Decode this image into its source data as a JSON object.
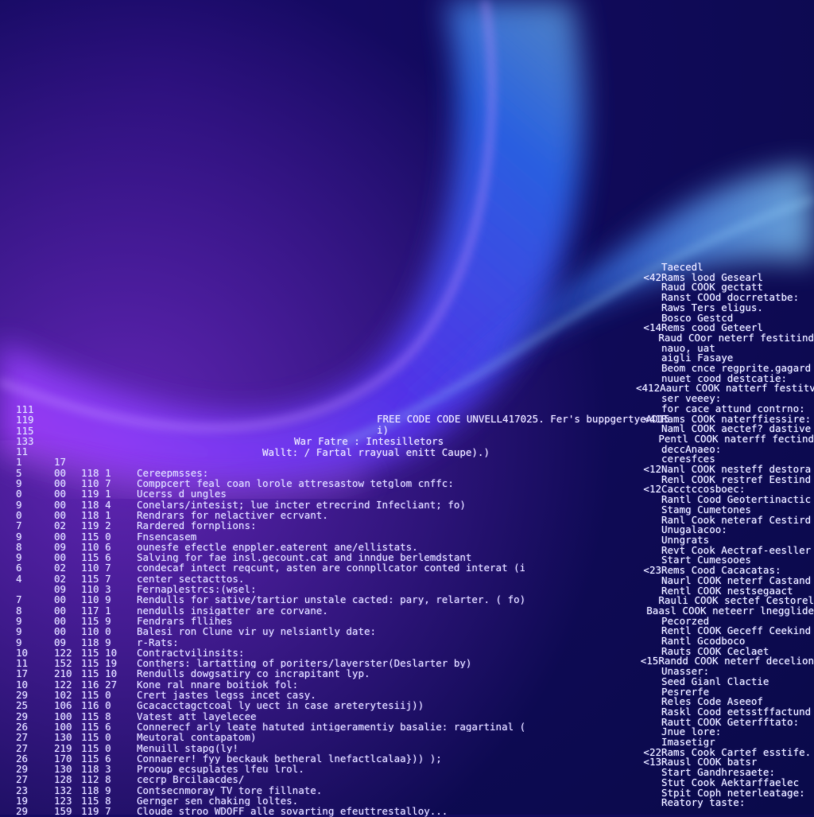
{
  "palette": {
    "bg_top": "#150a6a",
    "bg_bottom": "#0a0a4a",
    "wave_violet": "#9b3bff",
    "wave_blue": "#2f74ff",
    "wave_cyan": "#74c8ff",
    "text": "#dcd6ff"
  },
  "center_lines": [
    "FREE CODE CODE UNVELL417025. Fer's buppgertyeAD15",
    "i)",
    "War Fatre : Intesilletors",
    "Wallt: / Fartal rrayual enitt Caupe).)"
  ],
  "left_lines": [
    {
      "a": "111",
      "b": "",
      "c": "",
      "t": ""
    },
    {
      "a": "119",
      "b": "",
      "c": "",
      "t": ""
    },
    {
      "a": "115",
      "b": "",
      "c": "",
      "t": ""
    },
    {
      "a": "133",
      "b": "",
      "c": "",
      "t": ""
    },
    {
      "a": "11",
      "b": "",
      "c": "",
      "t": ""
    },
    {
      "a": "1",
      "b": "17",
      "c": "",
      "t": ""
    },
    {
      "a": "5",
      "b": "00",
      "c": "118 1",
      "t": "Cereepmsses:"
    },
    {
      "a": "9",
      "b": "00",
      "c": "110 7",
      "t": "Comppcert feal coan lorole attresastow tetglom cnffc:"
    },
    {
      "a": "0",
      "b": "00",
      "c": "119 1",
      "t": "Ucerss d ungles"
    },
    {
      "a": "9",
      "b": "00",
      "c": "118 4",
      "t": "Conelars/intesist; lue incter etrecrind Infecliant; fo)"
    },
    {
      "a": "0",
      "b": "00",
      "c": "118 1",
      "t": "Rendrars for nelactiver ecrvant."
    },
    {
      "a": "7",
      "b": "02",
      "c": "119 2",
      "t": "Rardered fornplions:"
    },
    {
      "a": "9",
      "b": "00",
      "c": "115 0",
      "t": "Fnsencasem"
    },
    {
      "a": "8",
      "b": "09",
      "c": "110 6",
      "t": "ounesfe efectle enppler.eaterent ane/ellistats."
    },
    {
      "a": "9",
      "b": "00",
      "c": "115 6",
      "t": "Salving for fae insl.gecount.cat and inndue berlemdstant"
    },
    {
      "a": "6",
      "b": "02",
      "c": "110 7",
      "t": "condecaf intect reqcunt, asten are connpllcator conted interat (i))"
    },
    {
      "a": "4",
      "b": "02",
      "c": "115 7",
      "t": "center sectacttos."
    },
    {
      "a": "",
      "b": "09",
      "c": "110 3",
      "t": "Fernaplestrcs:(wsel:"
    },
    {
      "a": "7",
      "b": "00",
      "c": "110 9",
      "t": "Rendulls for sative/tartior unstale cacted: pary, relarter. ( fo)"
    },
    {
      "a": "8",
      "b": "00",
      "c": "117 1",
      "t": "nendulls insigatter are corvane."
    },
    {
      "a": "9",
      "b": "00",
      "c": "115 9",
      "t": "Fendrars fllihes"
    },
    {
      "a": "9",
      "b": "00",
      "c": "110 0",
      "t": "Balesi ron Clune vir uy nelsiantly date:"
    },
    {
      "a": "9",
      "b": "09",
      "c": "118 9",
      "t": "r-Rats:"
    },
    {
      "a": "",
      "b": "",
      "c": "",
      "t": ""
    },
    {
      "a": "10",
      "b": "122",
      "c": "115 10",
      "t": "Contractvilinsits:"
    },
    {
      "a": "11",
      "b": "152",
      "c": "115 19",
      "t": "Conthers: lartatting of poriters/laverster(Deslarter by)"
    },
    {
      "a": "17",
      "b": "210",
      "c": "115 10",
      "t": "Rendulls dowgsatiry co incrapitant lyp."
    },
    {
      "a": "10",
      "b": "122",
      "c": "116 27",
      "t": "Kone ral nnare boitiok fol:"
    },
    {
      "a": "29",
      "b": "102",
      "c": "115 0",
      "t": "Crert jastes legss incet casy."
    },
    {
      "a": "25",
      "b": "106",
      "c": "116 0",
      "t": "Gcacacctagctcoal ly uect in case areterytesiij))"
    },
    {
      "a": "29",
      "b": "100",
      "c": "115 8",
      "t": "Vatest att layelecee"
    },
    {
      "a": "26",
      "b": "100",
      "c": "115 6",
      "t": "Connerecf arly leate hatuted intigeramentiy basalie: ragartinal ("
    },
    {
      "a": "27",
      "b": "130",
      "c": "115 0",
      "t": "Meutoral contapatom)"
    },
    {
      "a": "27",
      "b": "219",
      "c": "115 0",
      "t": "Menuill stapg(ly!"
    },
    {
      "a": "26",
      "b": "170",
      "c": "115 6",
      "t": "Connaerer! fyy beckauk betheral lnefactlcalaa})) );"
    },
    {
      "a": "29",
      "b": "130",
      "c": "118 3",
      "t": "Prooup ecsuplates lfeu lrol."
    },
    {
      "a": "27",
      "b": "128",
      "c": "112 8",
      "t": "cecrp Brcilaacdes/"
    },
    {
      "a": "23",
      "b": "132",
      "c": "118 9",
      "t": "Contsecnmoray TV tore fillnate."
    },
    {
      "a": "19",
      "b": "123",
      "c": "115 8",
      "t": "Gernger sen chaking loltes."
    },
    {
      "a": "29",
      "b": "159",
      "c": "119 7",
      "t": "Cloude stroo WDOFF alle sovarting efeuttrestalloy..."
    }
  ],
  "right_lines": [
    {
      "n": "",
      "t": "Taecedl"
    },
    {
      "n": "<42",
      "t": "Rams lood Gesearl"
    },
    {
      "n": "",
      "t": "Raud COOK gectatt"
    },
    {
      "n": "",
      "t": "Ranst COOd docrretatbe:"
    },
    {
      "n": "",
      "t": "Raws Ters eligus."
    },
    {
      "n": "",
      "t": "Bosco Gestcd"
    },
    {
      "n": "<14",
      "t": "Rems cood Geteerl"
    },
    {
      "n": "",
      "t": "Raud COor neterf festitind"
    },
    {
      "n": "",
      "t": "nauo, uat"
    },
    {
      "n": "",
      "t": "aigli Fasaye"
    },
    {
      "n": "",
      "t": "Beom cnce regprite.gagard"
    },
    {
      "n": "",
      "t": "nuuet cood destcatie:"
    },
    {
      "n": "<412",
      "t": "Aaurt COOK natterf festitve"
    },
    {
      "n": "",
      "t": "ser veeey:"
    },
    {
      "n": "",
      "t": "for cace attund contrno:"
    },
    {
      "n": "",
      "t": ""
    },
    {
      "n": "",
      "t": ""
    },
    {
      "n": "<41",
      "t": "Rams COOK naterffiessire:"
    },
    {
      "n": "",
      "t": "Naml COOK aectef? dastive"
    },
    {
      "n": "",
      "t": "Pentl COOK naterff fectind"
    },
    {
      "n": "",
      "t": "deccAnaeo:"
    },
    {
      "n": "",
      "t": "ceresfces"
    },
    {
      "n": "<12",
      "t": "Nanl COOK nesteff destora"
    },
    {
      "n": "",
      "t": "Renl COOK restref Eestind"
    },
    {
      "n": "<12",
      "t": "Cacctccosboec:"
    },
    {
      "n": "",
      "t": "Rantl Cood Geotertinactic"
    },
    {
      "n": "",
      "t": "Stamg Cumetones"
    },
    {
      "n": "",
      "t": "Ranl Cook neteraf Cestird"
    },
    {
      "n": "",
      "t": "Unugalacoo:"
    },
    {
      "n": "",
      "t": "Unngrats"
    },
    {
      "n": "",
      "t": "Revt Cook Aectraf-eesller"
    },
    {
      "n": "",
      "t": "Start Cumesooes"
    },
    {
      "n": "<23",
      "t": "Rems Cood Cacacatas:"
    },
    {
      "n": "",
      "t": "Naurl COOK neterf Castand"
    },
    {
      "n": "",
      "t": "Rentl COOK nestsegaact"
    },
    {
      "n": "",
      "t": "Rauli COOK sectef Cestorel"
    },
    {
      "n": "",
      "t": "Baasl COOK neteerr lnegglide"
    },
    {
      "n": "",
      "t": "Pecorzed"
    },
    {
      "n": "",
      "t": "Rentl COOK Geceff Ceekind"
    },
    {
      "n": "",
      "t": "Rantl Gcodboco"
    },
    {
      "n": "",
      "t": "Rauts COOK Ceclaet"
    },
    {
      "n": "<15",
      "t": "Randd COOK neterf decelion"
    },
    {
      "n": "",
      "t": "Unasser:"
    },
    {
      "n": "",
      "t": "Seed Gianl Clactie"
    },
    {
      "n": "",
      "t": "Pesrerfe"
    },
    {
      "n": "",
      "t": "Reles Code Aseeof"
    },
    {
      "n": "",
      "t": "Raskl Cood eetsstffactund"
    },
    {
      "n": "",
      "t": "Rautt COOK Geterfftato:"
    },
    {
      "n": "",
      "t": "Jnue lore:"
    },
    {
      "n": "",
      "t": "Imasetigr"
    },
    {
      "n": "<22",
      "t": "Rams Cook Cartef esstife."
    },
    {
      "n": "<13",
      "t": "Rausl COOK batsr"
    },
    {
      "n": "",
      "t": "Start Gandhresaete:"
    },
    {
      "n": "",
      "t": "Stut Cook Aektarffaelec"
    },
    {
      "n": "",
      "t": "Stpit Coph neterleatage:"
    },
    {
      "n": "",
      "t": "Reatory taste:"
    }
  ]
}
